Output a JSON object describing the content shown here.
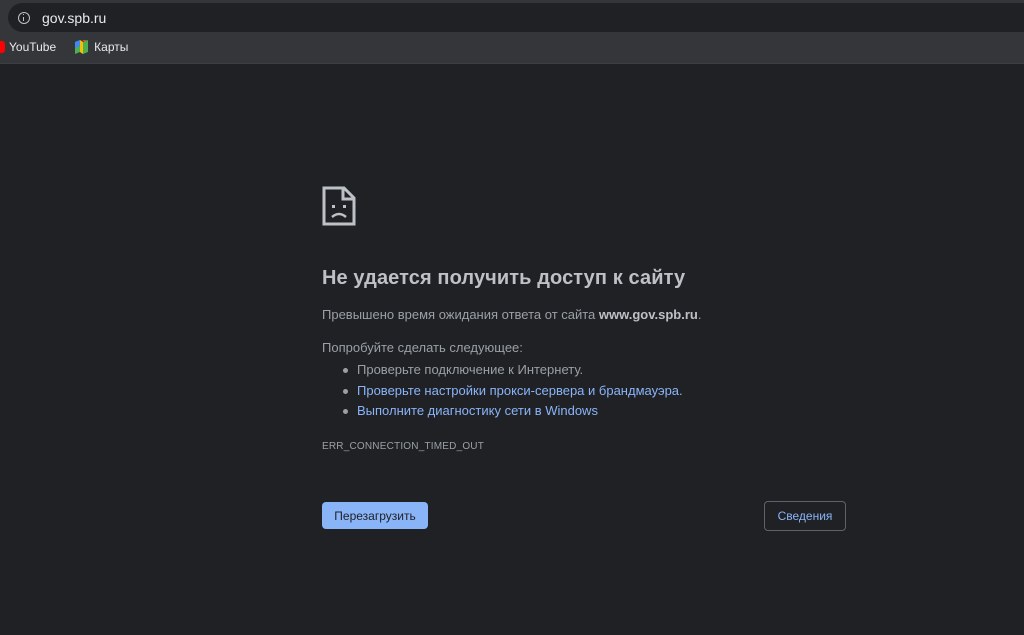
{
  "browser": {
    "url": "gov.spb.ru",
    "bookmarks": [
      {
        "label": "YouTube",
        "icon": "youtube-icon"
      },
      {
        "label": "Карты",
        "icon": "google-maps-icon"
      }
    ]
  },
  "error_page": {
    "icon": "sad-page-icon",
    "heading": "Не удается получить доступ к сайту",
    "summary_prefix": "Превышено время ожидания ответа от сайта ",
    "summary_host": "www.gov.spb.ru",
    "summary_suffix": ".",
    "suggestions_title": "Попробуйте сделать следующее:",
    "suggestions": [
      {
        "text": "Проверьте подключение к Интернету.",
        "is_link": false
      },
      {
        "text": "Проверьте настройки прокси-сервера и брандмауэра.",
        "is_link": true
      },
      {
        "text": "Выполните диагностику сети в Windows",
        "is_link": true
      }
    ],
    "error_code": "ERR_CONNECTION_TIMED_OUT",
    "reload_label": "Перезагрузить",
    "details_label": "Сведения"
  },
  "colors": {
    "background": "#202124",
    "link": "#8ab4f8",
    "primary_button": "#8ab4f8"
  }
}
